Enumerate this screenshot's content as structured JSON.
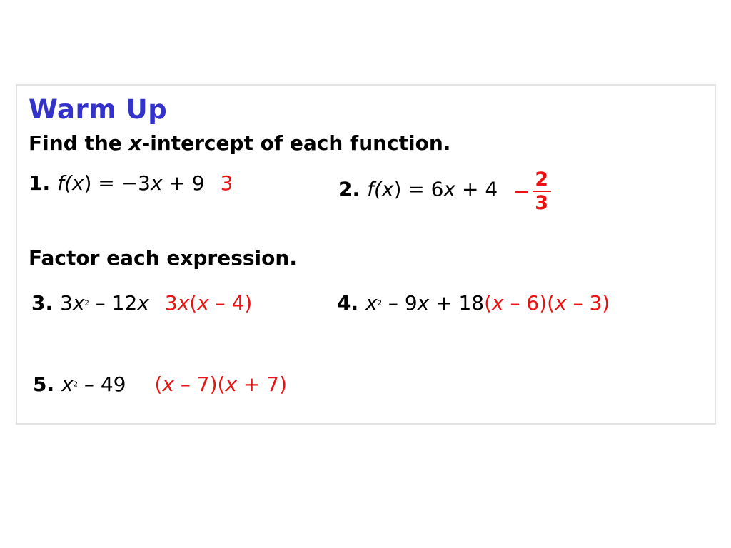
{
  "slide": {
    "background_color": "#ffffff",
    "box_border_color": "#e3e3e3",
    "title_color": "#3333cc",
    "answer_color": "#ee1111",
    "title": "Warm Up"
  },
  "section_1": {
    "heading_pre": "Find the ",
    "heading_var": "x",
    "heading_post": "-intercept of each function.",
    "problems": [
      {
        "number": "1.",
        "expr_pre": "f(",
        "expr_var": "x",
        "expr_mid": ") = −3",
        "expr_var2": "x",
        "expr_post": " + 9",
        "answer": "3"
      },
      {
        "number": "2.",
        "expr_pre": "f(",
        "expr_var": "x",
        "expr_mid": ") = 6",
        "expr_var2": "x",
        "expr_post": " + 4",
        "answer_sign": "−",
        "answer_numerator": "2",
        "answer_denominator": "3"
      }
    ]
  },
  "section_2": {
    "heading": "Factor each expression.",
    "problems": [
      {
        "number": "3.",
        "expr_a": "3",
        "expr_var": "x",
        "expr_exp": "2",
        "expr_b": " – 12",
        "expr_var2": "x",
        "ans_a": "3",
        "ans_var": "x",
        "ans_b": "(",
        "ans_var2": "x",
        "ans_c": " – 4)"
      },
      {
        "number": "4.",
        "expr_var": "x",
        "expr_exp": "2",
        "expr_b": " – 9",
        "expr_var2": "x",
        "expr_c": " + 18",
        "ans_a": "(",
        "ans_var": "x",
        "ans_b": " – 6)(",
        "ans_var2": "x",
        "ans_c": " – 3)"
      },
      {
        "number": "5.",
        "expr_var": "x",
        "expr_exp": "2",
        "expr_b": " – 49",
        "ans_a": "(",
        "ans_var": "x",
        "ans_b": " – 7)(",
        "ans_var2": "x",
        "ans_c": " + 7)"
      }
    ]
  }
}
